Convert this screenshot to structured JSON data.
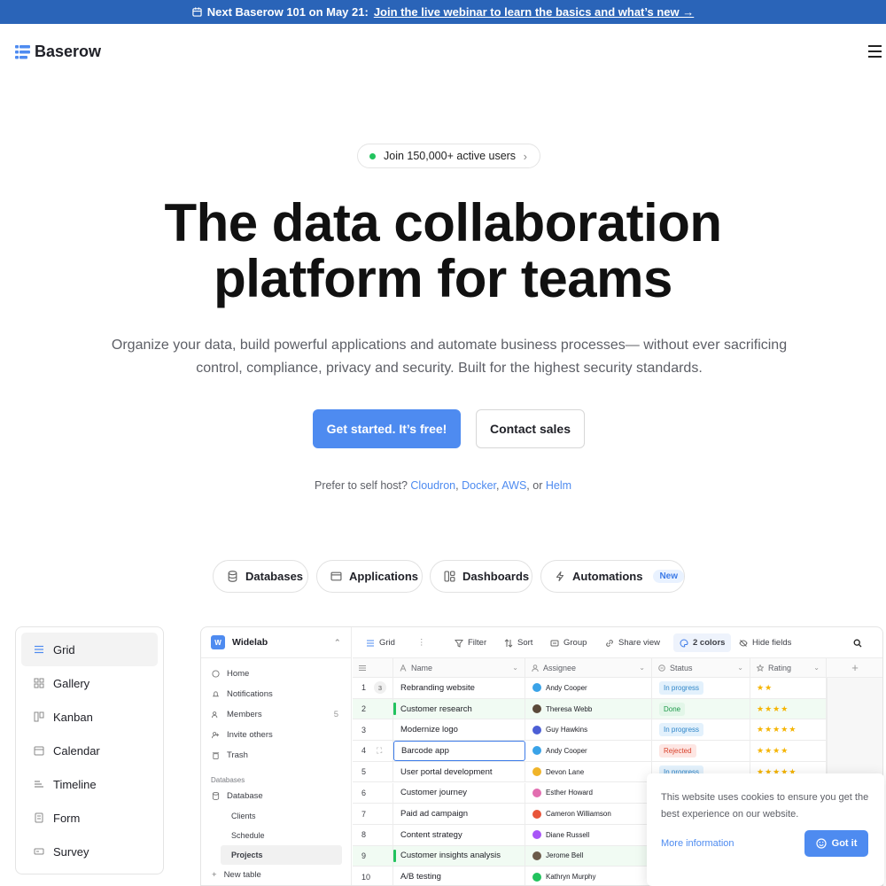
{
  "banner": {
    "lead": "Next Baserow 101 on May 21:",
    "link": "Join the live webinar to learn the basics and what’s new →"
  },
  "nav": {
    "brand": "Baserow"
  },
  "pill": {
    "label": "Join 150,000+ active users"
  },
  "hero": {
    "line1": "The data collaboration",
    "line2": "platform for teams"
  },
  "subtitle": {
    "line1": "Organize your data, build powerful applications and automate business processes— without ever sacrificing",
    "line2": "control, compliance, privacy and security. Built for the highest security standards."
  },
  "cta": {
    "primary": "Get started. It’s free!",
    "secondary": "Contact sales"
  },
  "selfhost": {
    "prefix": "Prefer to self host?",
    "l1": "Cloudron",
    "l2": "Docker",
    "l3": "AWS",
    "or": ", or",
    "l4": "Helm",
    "sep": ","
  },
  "product_tabs": [
    {
      "label": "Databases"
    },
    {
      "label": "Applications"
    },
    {
      "label": "Dashboards"
    },
    {
      "label": "Automations",
      "badge": "New"
    }
  ],
  "views": [
    "Grid",
    "Gallery",
    "Kanban",
    "Calendar",
    "Timeline",
    "Form",
    "Survey"
  ],
  "app": {
    "workspace": {
      "initial": "W",
      "name": "Widelab"
    },
    "menu": [
      "Home",
      "Notifications",
      "Members",
      "Invite others",
      "Trash"
    ],
    "members_count": "5",
    "databases_heading": "Databases",
    "database_name": "Database",
    "tables": [
      "Clients",
      "Schedule",
      "Projects"
    ],
    "new_table": "New table",
    "toolbar": {
      "view": "Grid",
      "filter": "Filter",
      "sort": "Sort",
      "group": "Group",
      "share": "Share view",
      "colors": "2 colors",
      "hide": "Hide fields"
    },
    "columns": [
      "Name",
      "Assignee",
      "Status",
      "Rating"
    ],
    "rows": [
      {
        "n": "1",
        "comments": "3",
        "name": "Rebranding website",
        "assignee": "Andy Cooper",
        "av": "#3aa3e8",
        "status": "In progress",
        "rating": 2,
        "hl": false
      },
      {
        "n": "2",
        "name": "Customer research",
        "assignee": "Theresa Webb",
        "av": "#5b4a3a",
        "status": "Done",
        "rating": 4,
        "hl": true
      },
      {
        "n": "3",
        "name": "Modernize logo",
        "assignee": "Guy Hawkins",
        "av": "#4c5fd5",
        "status": "In progress",
        "rating": 5,
        "hl": false
      },
      {
        "n": "4",
        "name": "Barcode app",
        "assignee": "Andy Cooper",
        "av": "#3aa3e8",
        "status": "Rejected",
        "rating": 4,
        "hl": false,
        "edit": true
      },
      {
        "n": "5",
        "name": "User portal development",
        "assignee": "Devon Lane",
        "av": "#f0b429",
        "status": "In progress",
        "rating": 5,
        "hl": false
      },
      {
        "n": "6",
        "name": "Customer journey",
        "assignee": "Esther Howard",
        "av": "#e26eb0",
        "status": "",
        "rating": 0,
        "hl": false
      },
      {
        "n": "7",
        "name": "Paid ad campaign",
        "assignee": "Cameron Williamson",
        "av": "#e8553a",
        "status": "",
        "rating": 0,
        "hl": false
      },
      {
        "n": "8",
        "name": "Content strategy",
        "assignee": "Diane Russell",
        "av": "#a855f7",
        "status": "",
        "rating": 0,
        "hl": false
      },
      {
        "n": "9",
        "name": "Customer insights analysis",
        "assignee": "Jerome Bell",
        "av": "#6b5a4a",
        "status": "",
        "rating": 0,
        "hl": true
      },
      {
        "n": "10",
        "name": "A/B testing",
        "assignee": "Kathryn Murphy",
        "av": "#22c35e",
        "status": "In progress",
        "rating": 4,
        "hl": false
      }
    ]
  },
  "colors": {
    "brand": "#4e8bf0",
    "banner": "#2a64b8",
    "progress_bg": "#e3f1fc",
    "progress_fg": "#2f86c9",
    "done_bg": "#e2f6e8",
    "done_fg": "#1f9a4b",
    "rejected_bg": "#fde6e3",
    "rejected_fg": "#d9422c"
  },
  "cookie": {
    "text": "This website uses cookies to ensure you get the best experience on our website.",
    "more": "More information",
    "button": "Got it"
  }
}
